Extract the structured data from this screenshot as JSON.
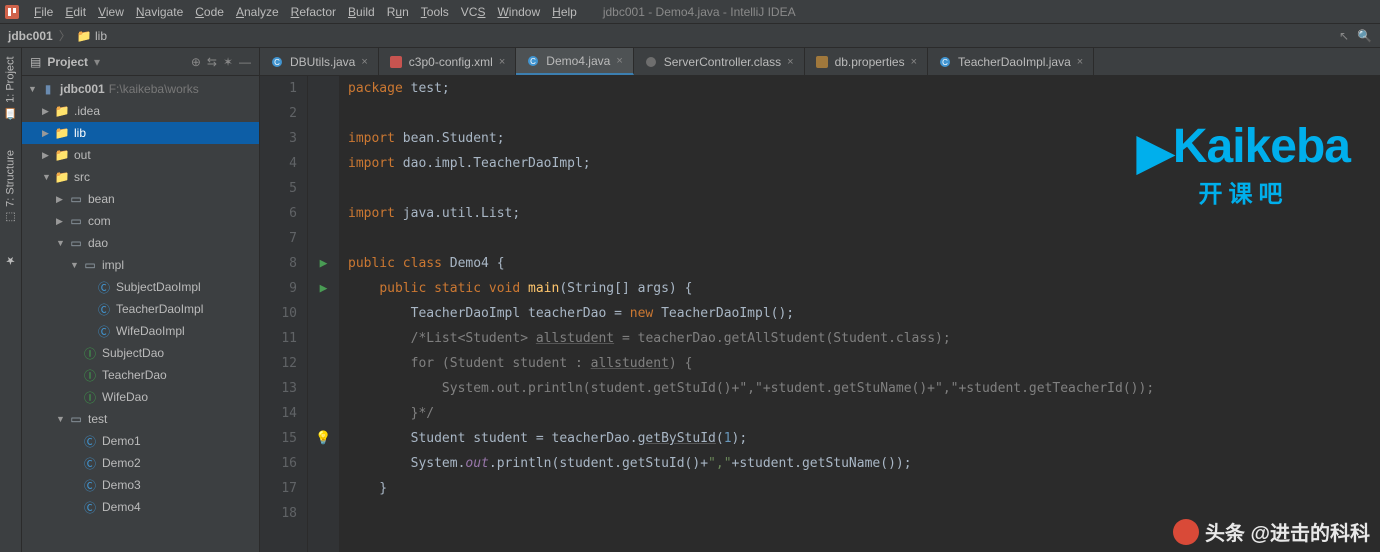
{
  "menubar": {
    "items": [
      {
        "label": "File",
        "u": "F"
      },
      {
        "label": "Edit",
        "u": "E"
      },
      {
        "label": "View",
        "u": "V"
      },
      {
        "label": "Navigate",
        "u": "N"
      },
      {
        "label": "Code",
        "u": "C"
      },
      {
        "label": "Analyze",
        "u": "A"
      },
      {
        "label": "Refactor",
        "u": "R"
      },
      {
        "label": "Build",
        "u": "B"
      },
      {
        "label": "Run",
        "u": "u"
      },
      {
        "label": "Tools",
        "u": "T"
      },
      {
        "label": "VCS",
        "u": "S"
      },
      {
        "label": "Window",
        "u": "W"
      },
      {
        "label": "Help",
        "u": "H"
      }
    ],
    "title": "jdbc001 - Demo4.java - IntelliJ IDEA"
  },
  "breadcrumbs": {
    "project": "jdbc001",
    "path": "lib"
  },
  "sidebarTabs": {
    "project": "1: Project",
    "structure": "7: Structure"
  },
  "projectPanel": {
    "title": "Project",
    "root": {
      "label": "jdbc001",
      "trail": "F:\\kaikeba\\works"
    },
    "nodes": [
      {
        "label": ".idea",
        "depth": 1,
        "kind": "dir",
        "arrow": "▶"
      },
      {
        "label": "lib",
        "depth": 1,
        "kind": "dir",
        "arrow": "▶",
        "selected": true
      },
      {
        "label": "out",
        "depth": 1,
        "kind": "out",
        "arrow": "▶"
      },
      {
        "label": "src",
        "depth": 1,
        "kind": "src",
        "arrow": "▼"
      },
      {
        "label": "bean",
        "depth": 2,
        "kind": "pkg",
        "arrow": "▶"
      },
      {
        "label": "com",
        "depth": 2,
        "kind": "pkg",
        "arrow": "▶"
      },
      {
        "label": "dao",
        "depth": 2,
        "kind": "pkg",
        "arrow": "▼"
      },
      {
        "label": "impl",
        "depth": 3,
        "kind": "pkg",
        "arrow": "▼"
      },
      {
        "label": "SubjectDaoImpl",
        "depth": 4,
        "kind": "class"
      },
      {
        "label": "TeacherDaoImpl",
        "depth": 4,
        "kind": "class"
      },
      {
        "label": "WifeDaoImpl",
        "depth": 4,
        "kind": "class"
      },
      {
        "label": "SubjectDao",
        "depth": 3,
        "kind": "iface"
      },
      {
        "label": "TeacherDao",
        "depth": 3,
        "kind": "iface"
      },
      {
        "label": "WifeDao",
        "depth": 3,
        "kind": "iface"
      },
      {
        "label": "test",
        "depth": 2,
        "kind": "pkg",
        "arrow": "▼"
      },
      {
        "label": "Demo1",
        "depth": 3,
        "kind": "class"
      },
      {
        "label": "Demo2",
        "depth": 3,
        "kind": "class"
      },
      {
        "label": "Demo3",
        "depth": 3,
        "kind": "class"
      },
      {
        "label": "Demo4",
        "depth": 3,
        "kind": "class"
      }
    ]
  },
  "editorTabs": [
    {
      "label": "DBUtils.java",
      "icon": "class",
      "active": false
    },
    {
      "label": "c3p0-config.xml",
      "icon": "xml",
      "active": false
    },
    {
      "label": "Demo4.java",
      "icon": "class",
      "active": true
    },
    {
      "label": "ServerController.class",
      "icon": "classfile",
      "active": false
    },
    {
      "label": "db.properties",
      "icon": "props",
      "active": false
    },
    {
      "label": "TeacherDaoImpl.java",
      "icon": "class",
      "active": false
    }
  ],
  "code": {
    "lines": [
      {
        "n": 1,
        "html": "<span class='kw'>package</span> test;"
      },
      {
        "n": 2,
        "html": ""
      },
      {
        "n": 3,
        "html": "<span class='kw'>import</span> bean.Student;"
      },
      {
        "n": 4,
        "html": "<span class='kw'>import</span> dao.impl.TeacherDaoImpl;"
      },
      {
        "n": 5,
        "html": ""
      },
      {
        "n": 6,
        "html": "<span class='kw'>import</span> java.util.List;"
      },
      {
        "n": 7,
        "html": ""
      },
      {
        "n": 8,
        "html": "<span class='kw'>public class</span> Demo4 {",
        "run": true
      },
      {
        "n": 9,
        "html": "    <span class='kw'>public static void</span> <span style='color:#ffc66d'>main</span>(String[] args) {",
        "run": true
      },
      {
        "n": 10,
        "html": "        TeacherDaoImpl teacherDao = <span class='kw'>new</span> TeacherDaoImpl();"
      },
      {
        "n": 11,
        "html": "        <span class='com'>/*List&lt;Student&gt; <span class='under'>allstudent</span> = teacherDao.getAllStudent(Student.class);</span>"
      },
      {
        "n": 12,
        "html": "<span class='com'>        for (Student student : <span class='under'>allstudent</span>) {</span>"
      },
      {
        "n": 13,
        "html": "<span class='com'>            System.out.println(student.getStuId()+\",\"+student.getStuName()+\",\"+student.getTeacherId());</span>"
      },
      {
        "n": 14,
        "html": "<span class='com'>        }*/</span>"
      },
      {
        "n": 15,
        "html": "        Student student = teacherDao.<span class='under'>getByStuId</span>(<span class='num'>1</span>);",
        "bulb": true
      },
      {
        "n": 16,
        "html": "        System.<span class='field'>out</span>.println(student.getStuId()+<span class='str'>\",\"</span>+student.getStuName());"
      },
      {
        "n": 17,
        "html": "    }"
      },
      {
        "n": 18,
        "html": ""
      }
    ]
  },
  "logo": {
    "big": "Kaikeba",
    "sub": "开课吧"
  },
  "watermark": {
    "text": "头条 @进击的科科"
  }
}
